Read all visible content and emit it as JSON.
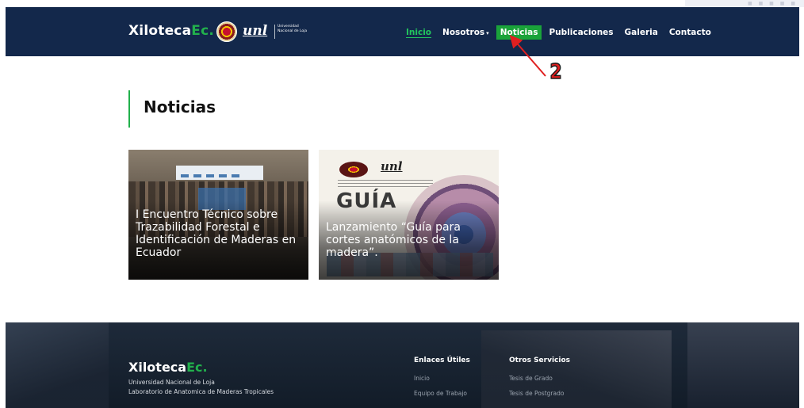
{
  "navbar": {
    "brand_main": "Xiloteca",
    "brand_accent": "Ec.",
    "unl_logo": "unl",
    "unl_text": "Universidad Nacional de Loja",
    "items": [
      {
        "label": "Inicio",
        "state": "active"
      },
      {
        "label": "Nosotros",
        "has_dropdown": true
      },
      {
        "label": "Noticias",
        "state": "highlighted"
      },
      {
        "label": "Publicaciones"
      },
      {
        "label": "Galeria"
      },
      {
        "label": "Contacto"
      }
    ]
  },
  "annotation": {
    "number": "2",
    "color": "#e02020"
  },
  "section": {
    "title": "Noticias",
    "accent_color": "#22b14c"
  },
  "news": [
    {
      "title": "I Encuentro Técnico sobre Trazabilidad Forestal e Identificación de Maderas en Ecuador"
    },
    {
      "title": "Lanzamiento “Guía para cortes anatómicos de la madera”.",
      "image_text": "GUÍA",
      "image_logo": "unl"
    }
  ],
  "footer": {
    "brand_main": "Xiloteca",
    "brand_accent": "Ec.",
    "line1": "Universidad Nacional de Loja",
    "line2": "Laboratorio de Anatomica de Maderas Tropicales",
    "col1": {
      "title": "Enlaces Útiles",
      "links": [
        "Inicio",
        "Equipo de Trabajo"
      ]
    },
    "col2": {
      "title": "Otros Servicios",
      "links": [
        "Tesis de Grado",
        "Tesis de Postgrado"
      ]
    }
  },
  "colors": {
    "navbar_bg": "#13284b",
    "accent_green": "#22b14c",
    "footer_bg": "#121c28"
  }
}
